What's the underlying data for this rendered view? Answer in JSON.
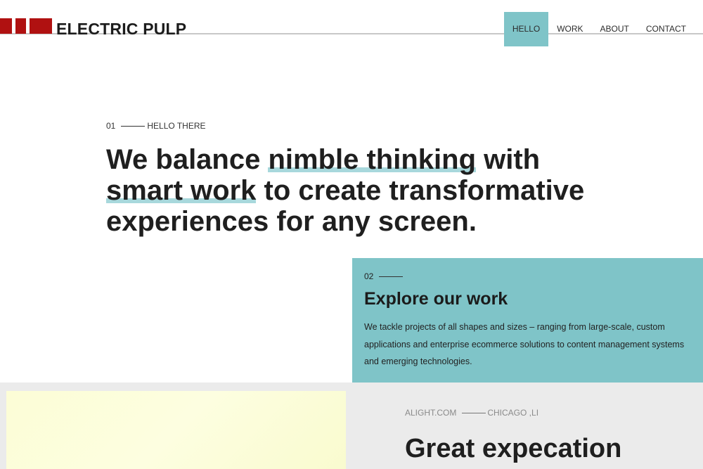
{
  "header": {
    "brand": "ELECTRIC PULP",
    "nav": [
      {
        "label": "HELLO",
        "active": true
      },
      {
        "label": "WORK",
        "active": false
      },
      {
        "label": "ABOUT",
        "active": false
      },
      {
        "label": "CONTACT",
        "active": false
      }
    ],
    "accent_color": "#7fc4c8",
    "brand_color": "#b01111"
  },
  "hero": {
    "number": "01",
    "kicker": "HELLO THERE",
    "title_part1": "We balance ",
    "title_highlight1": "nimble thinking",
    "title_part2": " with ",
    "title_highlight2": "smart work",
    "title_part3": " to create transformative experiences for any screen."
  },
  "explore": {
    "number": "02",
    "title": "Explore our work",
    "description": "We tackle projects of all shapes and sizes – ranging from large-scale, custom applications and enterprise ecommerce solutions to content management systems and emerging technologies."
  },
  "project": {
    "site": "ALIGHT.COM",
    "location": "CHICAGO ,LI",
    "title": "Great expecation"
  }
}
